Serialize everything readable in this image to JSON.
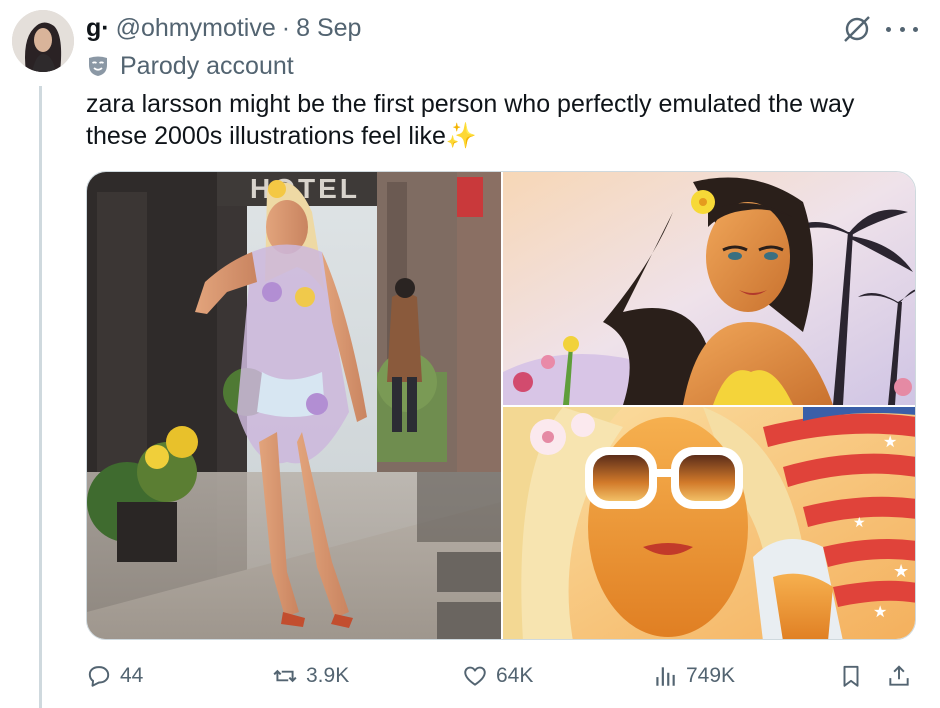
{
  "tweet": {
    "display_name": "g·",
    "handle": "@ohmymotive",
    "separator": "·",
    "date": "8 Sep",
    "label": "Parody account",
    "text_line1": "zara larsson might be the first person who perfectly emulated the way",
    "text_line2": "these 2000s illustrations feel like✨"
  },
  "media": {
    "sign_text": "HOTEL"
  },
  "actions": {
    "replies": "44",
    "reposts": "3.9K",
    "likes": "64K",
    "views": "749K"
  },
  "colors": {
    "text": "#0f1419",
    "secondary": "#536471",
    "thread_line": "#cfd9de"
  }
}
